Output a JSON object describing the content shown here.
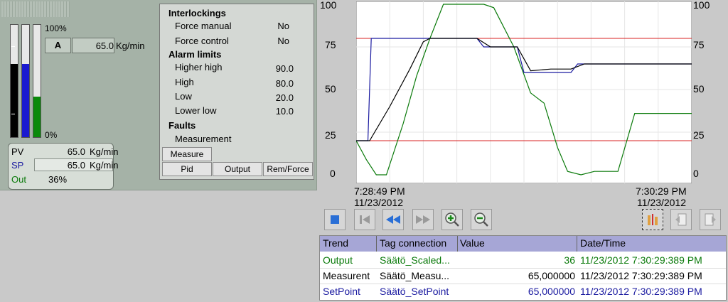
{
  "colors": {
    "output": "#0a7a0a",
    "setpoint": "#1a1aa0",
    "measurement": "#000000",
    "limit": "#d82020"
  },
  "faceplate": {
    "pct_top": "100%",
    "pct_bottom": "0%",
    "mode": "A",
    "flow_value": "65.0",
    "flow_unit": "Kg/min",
    "bars": {
      "pv_fraction": 0.65,
      "sp_fraction": 0.65,
      "out_fraction": 0.36
    },
    "pv_label": "PV",
    "pv_value": "65.0",
    "pv_unit": "Kg/min",
    "sp_label": "SP",
    "sp_value": "65.0",
    "sp_unit": "Kg/min",
    "out_label": "Out",
    "out_value": "36%"
  },
  "info": {
    "interlockings": "Interlockings",
    "force_manual_label": "Force manual",
    "force_manual_value": "No",
    "force_control_label": "Force control",
    "force_control_value": "No",
    "alarm_limits": "Alarm limits",
    "higher_high_label": "Higher high",
    "higher_high_value": "90.0",
    "high_label": "High",
    "high_value": "80.0",
    "low_label": "Low",
    "low_value": "20.0",
    "lower_low_label": "Lower low",
    "lower_low_value": "10.0",
    "faults": "Faults",
    "measurement_label": "Measurement",
    "btn_measure": "Measure",
    "btn_pid": "Pid",
    "btn_output": "Output",
    "btn_remforce": "Rem/Force"
  },
  "trend": {
    "y_ticks": [
      "100",
      "75",
      "50",
      "25",
      "0"
    ],
    "x_start_time": "7:28:49 PM",
    "x_start_date": "11/23/2012",
    "x_end_time": "7:30:29 PM",
    "x_end_date": "11/23/2012"
  },
  "chart_data": {
    "type": "line",
    "ylim": [
      0,
      100
    ],
    "x_range": [
      "7:28:49 PM",
      "7:30:29 PM"
    ],
    "grid": true,
    "reference_lines": [
      80,
      20
    ],
    "series": [
      {
        "name": "Output",
        "color": "#0a7a0a",
        "x": [
          0,
          3,
          6,
          9,
          14,
          18,
          22,
          26,
          33,
          38,
          41,
          47,
          52,
          56,
          60,
          63,
          67,
          71,
          75,
          78,
          83,
          88,
          91,
          100
        ],
        "y": [
          20,
          9,
          0,
          0,
          30,
          58,
          80,
          100,
          100,
          100,
          98,
          75,
          48,
          42,
          16,
          2,
          0,
          2,
          2,
          2,
          36,
          36,
          36,
          36
        ]
      },
      {
        "name": "SetPoint",
        "color": "#1a1aa0",
        "x": [
          0,
          3.5,
          4.5,
          5,
          36,
          38,
          48,
          50,
          57,
          64,
          66,
          100
        ],
        "y": [
          20,
          20,
          80,
          80,
          80,
          75,
          75,
          60,
          60,
          60,
          65,
          65
        ]
      },
      {
        "name": "Measurent",
        "color": "#000000",
        "x": [
          0,
          4,
          10,
          16,
          20,
          22,
          36,
          40,
          48,
          52,
          58,
          64,
          68,
          100
        ],
        "y": [
          20,
          20,
          40,
          62,
          78,
          80,
          80,
          75,
          75,
          61,
          62,
          62,
          65,
          65
        ]
      }
    ]
  },
  "toolbar": {
    "buttons": [
      "stop-icon",
      "first-icon",
      "rewind-icon",
      "forward-icon",
      "zoom-in-icon",
      "zoom-out-icon",
      "ruler-icon",
      "prev-page-icon",
      "next-page-icon"
    ]
  },
  "table": {
    "headers": [
      "Trend",
      "Tag connection",
      "Value",
      "Date/Time"
    ],
    "rows": [
      {
        "trend": "Output",
        "tag": "Säätö_Scaled...",
        "value": "36",
        "date": "11/23/2012 7:30:29:389 PM",
        "color": "#0a7a0a"
      },
      {
        "trend": "Measurent",
        "tag": "Säätö_Measu...",
        "value": "65,000000",
        "date": "11/23/2012 7:30:29:389 PM",
        "color": "#000000"
      },
      {
        "trend": "SetPoint",
        "tag": "Säätö_SetPoint",
        "value": "65,000000",
        "date": "11/23/2012 7:30:29:389 PM",
        "color": "#1a1aa0"
      }
    ]
  }
}
